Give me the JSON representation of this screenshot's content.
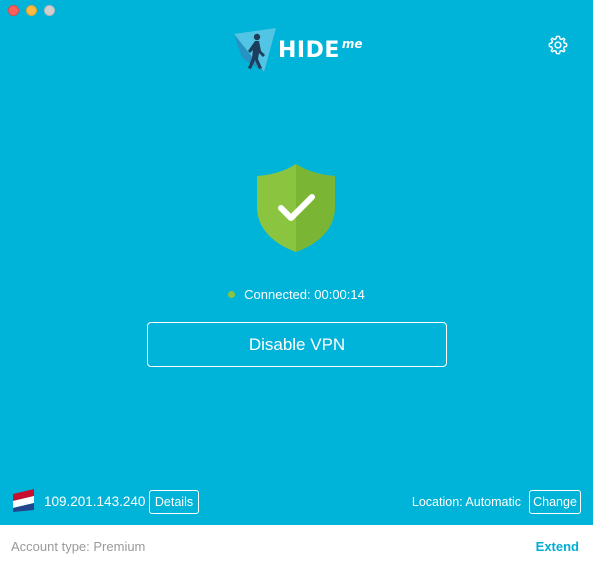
{
  "app": {
    "logo_text": "HIDE",
    "logo_suffix": "me"
  },
  "colors": {
    "background": "#00b3d8",
    "shield": "#8bc540",
    "accent": "#00aed3"
  },
  "status": {
    "text": "Connected: 00:00:14"
  },
  "vpn": {
    "button_label": "Disable VPN"
  },
  "connection": {
    "ip": "109.201.143.240",
    "details_label": "Details",
    "location_text": "Location: Automatic",
    "change_label": "Change",
    "flag_icon": "netherlands-flag-icon"
  },
  "footer": {
    "account_text": "Account type: Premium",
    "extend_label": "Extend"
  }
}
